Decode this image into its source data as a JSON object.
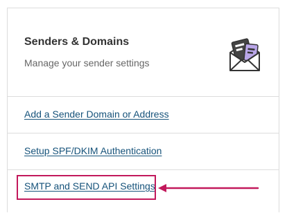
{
  "card": {
    "title": "Senders & Domains",
    "subtitle": "Manage your sender settings",
    "icon": "envelope-letter-icon"
  },
  "links": [
    {
      "label": "Add a Sender Domain or Address"
    },
    {
      "label": "Setup SPF/DKIM Authentication"
    },
    {
      "label": "SMTP and SEND API Settings"
    }
  ],
  "colors": {
    "link": "#15527a",
    "highlight": "#c2185b",
    "border": "#dcdcdc"
  }
}
